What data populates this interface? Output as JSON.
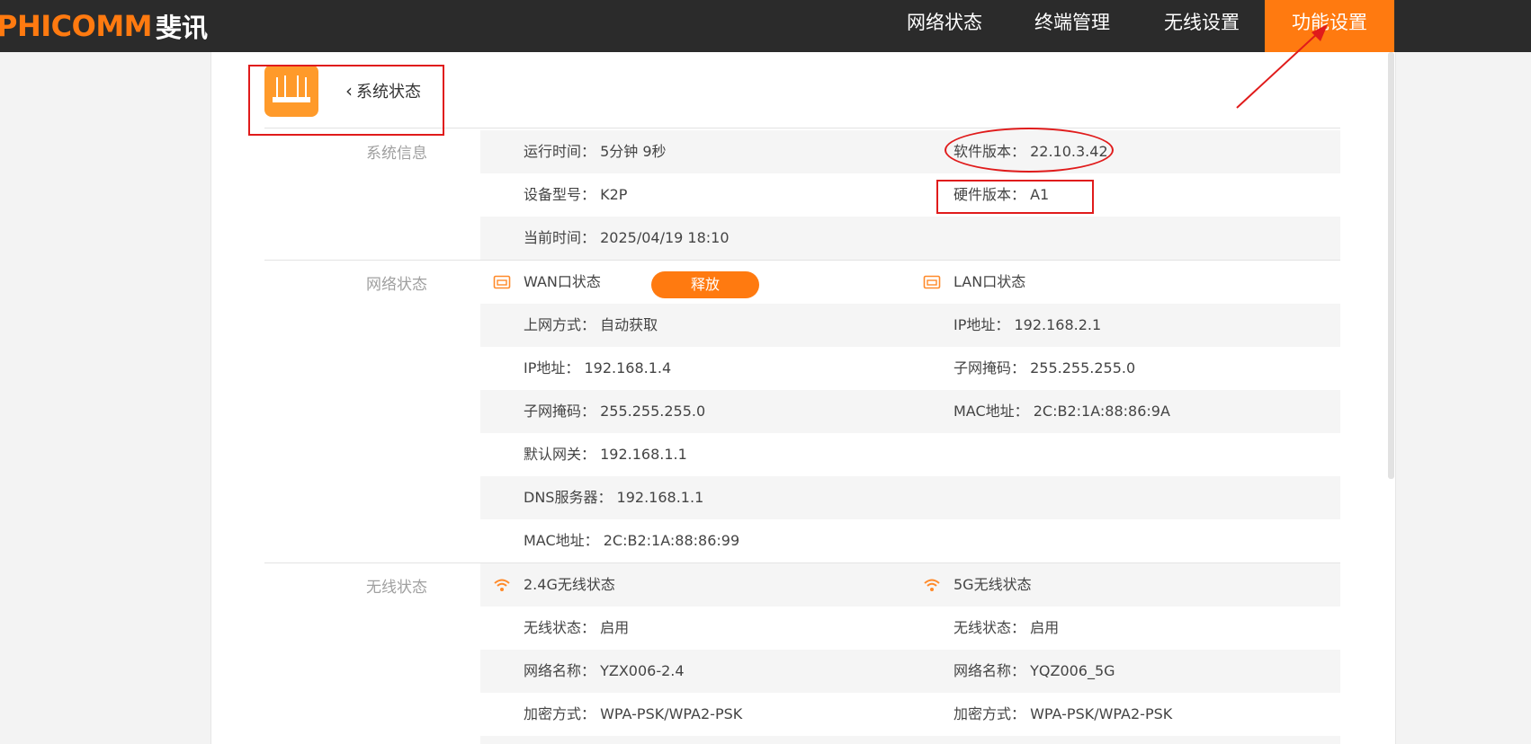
{
  "brand": {
    "name": "PHICOMM",
    "cn_name": "斐讯"
  },
  "nav": {
    "items": [
      {
        "label": "网络状态"
      },
      {
        "label": "终端管理"
      },
      {
        "label": "无线设置"
      },
      {
        "label": "功能设置",
        "active": true
      }
    ]
  },
  "header": {
    "back_label": "系统状态"
  },
  "sections": {
    "system": {
      "label": "系统信息",
      "uptime_key": "运行时间：",
      "uptime_value": "5分钟 9秒",
      "software_key": "软件版本：",
      "software_value": "22.10.3.42",
      "model_key": "设备型号：",
      "model_value": "K2P",
      "hardware_key": "硬件版本：",
      "hardware_value": "A1",
      "time_key": "当前时间：",
      "time_value": "2025/04/19 18:10"
    },
    "network": {
      "label": "网络状态",
      "wan_title": "WAN口状态",
      "release_label": "释放",
      "lan_title": "LAN口状态",
      "wan": [
        {
          "key": "上网方式：",
          "value": "自动获取"
        },
        {
          "key": "IP地址：",
          "value": "192.168.1.4"
        },
        {
          "key": "子网掩码：",
          "value": "255.255.255.0"
        },
        {
          "key": "默认网关：",
          "value": "192.168.1.1"
        },
        {
          "key": "DNS服务器：",
          "value": "192.168.1.1"
        },
        {
          "key": "MAC地址：",
          "value": "2C:B2:1A:88:86:99"
        }
      ],
      "lan": [
        {
          "key": "IP地址：",
          "value": "192.168.2.1"
        },
        {
          "key": "子网掩码：",
          "value": "255.255.255.0"
        },
        {
          "key": "MAC地址：",
          "value": "2C:B2:1A:88:86:9A"
        }
      ]
    },
    "wireless": {
      "label": "无线状态",
      "w24_title": "2.4G无线状态",
      "w5_title": "5G无线状态",
      "w24": [
        {
          "key": "无线状态：",
          "value": "启用"
        },
        {
          "key": "网络名称：",
          "value": "YZX006-2.4"
        },
        {
          "key": "加密方式：",
          "value": "WPA-PSK/WPA2-PSK"
        }
      ],
      "w5": [
        {
          "key": "无线状态：",
          "value": "启用"
        },
        {
          "key": "网络名称：",
          "value": "YQZ006_5G"
        },
        {
          "key": "加密方式：",
          "value": "WPA-PSK/WPA2-PSK"
        }
      ]
    }
  },
  "colors": {
    "accent": "#ff7a10",
    "topbar": "#2b2b2b",
    "annotation": "#e01b1b"
  }
}
